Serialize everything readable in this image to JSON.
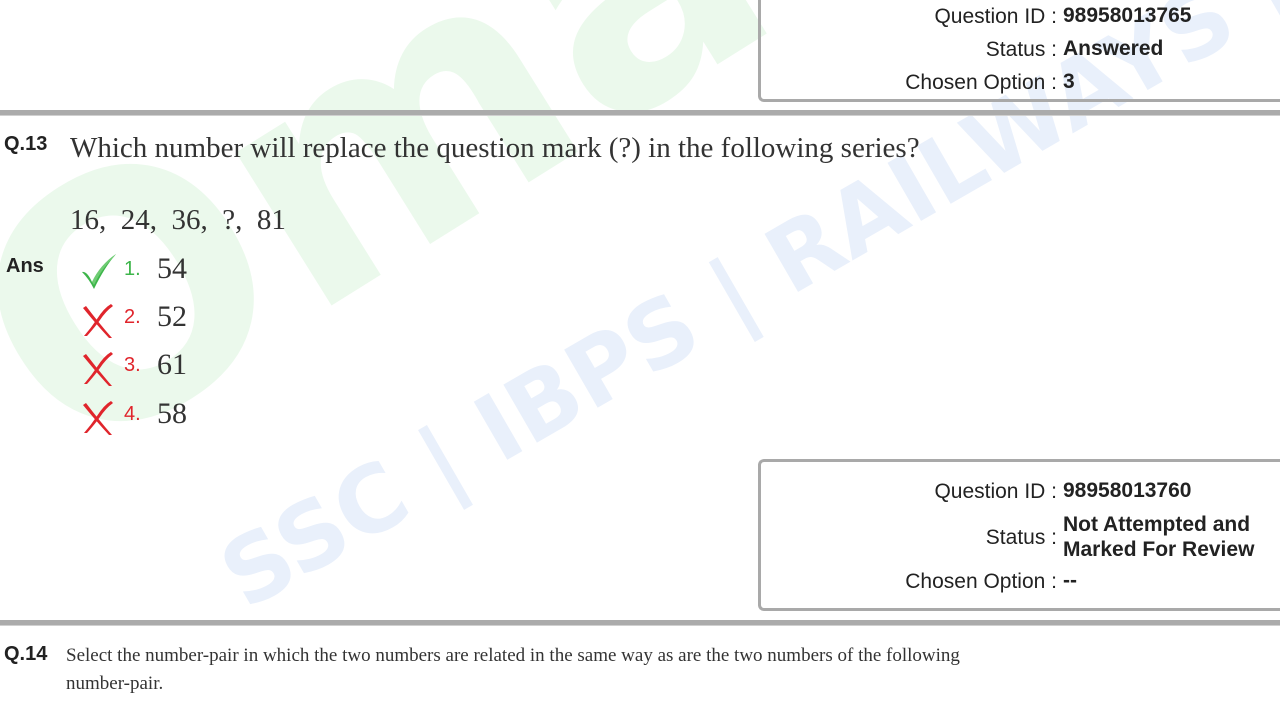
{
  "watermark": {
    "main": "Omaths.in",
    "sub": "SSC | IBPS | RAILWAYS | LIC | SIDBI"
  },
  "prev_question": {
    "question_id_label": "Question ID :",
    "question_id": "98958013765",
    "status_label": "Status :",
    "status": "Answered",
    "chosen_label": "Chosen Option :",
    "chosen": "3"
  },
  "q13": {
    "number": "Q.13",
    "text": "Which number will replace the question mark (?) in the following series?",
    "series": "16,  24,  36,  ?,  81",
    "ans_label": "Ans",
    "options": [
      {
        "num": "1.",
        "text": "54",
        "correct": true
      },
      {
        "num": "2.",
        "text": "52",
        "correct": false
      },
      {
        "num": "3.",
        "text": "61",
        "correct": false
      },
      {
        "num": "4.",
        "text": "58",
        "correct": false
      }
    ],
    "colors": {
      "correct": "#3db54a",
      "wrong": "#e0252c"
    },
    "question_id_label": "Question ID :",
    "question_id": "98958013760",
    "status_label": "Status :",
    "status_line1": "Not Attempted and",
    "status_line2": "Marked For Review",
    "chosen_label": "Chosen Option :",
    "chosen": "--"
  },
  "q14": {
    "number": "Q.14",
    "text_line1": "Select the number-pair in which the two numbers are related in the same way as are the two numbers of the following",
    "text_line2": "number-pair."
  }
}
